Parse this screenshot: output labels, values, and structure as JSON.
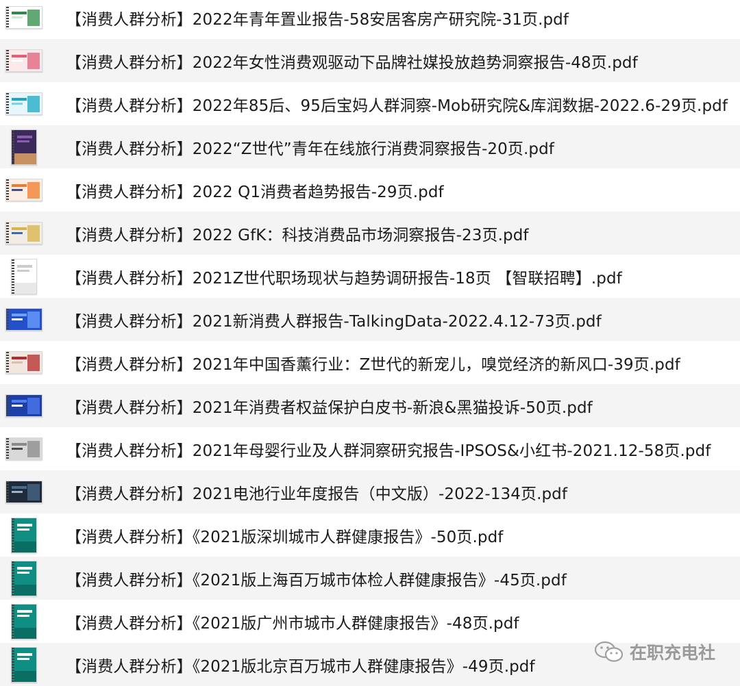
{
  "files": [
    {
      "name": "【消费人群分析】2022年青年置业报告-58安居客房产研究院-31页.pdf",
      "thumb": {
        "shape": "land",
        "bg": "#ffffff",
        "accent": "#2e8b47",
        "accent2": "#cfe9d6"
      }
    },
    {
      "name": "【消费人群分析】2022年女性消费观驱动下品牌社媒投放趋势洞察报告-48页.pdf",
      "thumb": {
        "shape": "land",
        "bg": "#fbe9ec",
        "accent": "#e0607a",
        "accent2": "#ffffff"
      }
    },
    {
      "name": "【消费人群分析】2022年85后、95后宝妈人群洞察-Mob研究院&库润数据-2022.6-29页.pdf",
      "thumb": {
        "shape": "land",
        "bg": "#e6f6fa",
        "accent": "#1aa7c4",
        "accent2": "#7ad3e3"
      }
    },
    {
      "name": "【消费人群分析】2022“Z世代”青年在线旅行消费洞察报告-20页.pdf",
      "thumb": {
        "shape": "port",
        "bg": "#3b2a5a",
        "accent": "#8a5db0",
        "accent2": "#c79060"
      }
    },
    {
      "name": "【消费人群分析】2022 Q1消费者趋势报告-29页.pdf",
      "thumb": {
        "shape": "land",
        "bg": "#fdeee3",
        "accent": "#f07a2a",
        "accent2": "#4a4a8a"
      }
    },
    {
      "name": "【消费人群分析】2022 GfK：科技消费品市场洞察报告-23页.pdf",
      "thumb": {
        "shape": "land",
        "bg": "#f1ede4",
        "accent": "#d8b24a",
        "accent2": "#3d67b0"
      }
    },
    {
      "name": "【消费人群分析】2021Z世代职场现状与趋势调研报告-18页 【智联招聘】.pdf",
      "thumb": {
        "shape": "port",
        "bg": "#ffffff",
        "accent": "#cccccc",
        "accent2": "#e8e8e8"
      }
    },
    {
      "name": "【消费人群分析】2021新消费人群报告-TalkingData-2022.4.12-73页.pdf",
      "thumb": {
        "shape": "land",
        "bg": "#2350c8",
        "accent": "#6fa0ff",
        "accent2": "#ffffff"
      }
    },
    {
      "name": "【消费人群分析】2021年中国香薰行业：Z世代的新宠儿，嗅觉经济的新风口-39页.pdf",
      "thumb": {
        "shape": "land",
        "bg": "#f3e6df",
        "accent": "#b32a2a",
        "accent2": "#d7bfb2"
      }
    },
    {
      "name": "【消费人群分析】2021年消费者权益保护白皮书-新浪&黑猫投诉-50页.pdf",
      "thumb": {
        "shape": "land",
        "bg": "#1d3fa8",
        "accent": "#4f7cf0",
        "accent2": "#ffffff"
      }
    },
    {
      "name": "【消费人群分析】2021年母婴行业及人群洞察研究报告-IPSOS&小红书-2021.12-58页.pdf",
      "thumb": {
        "shape": "land",
        "bg": "#d9d9d9",
        "accent": "#8a8a8a",
        "accent2": "#4a4a4a"
      }
    },
    {
      "name": "【消费人群分析】2021电池行业年度报告（中文版）-2022-134页.pdf",
      "thumb": {
        "shape": "land",
        "bg": "#1f2a3a",
        "accent": "#4a6a8a",
        "accent2": "#9fb3c8"
      }
    },
    {
      "name": "【消费人群分析】《2021版深圳城市人群健康报告》-50页.pdf",
      "thumb": {
        "shape": "port",
        "bg": "#0f8f83",
        "accent": "#ffffff",
        "accent2": "#0b6e65"
      }
    },
    {
      "name": "【消费人群分析】《2021版上海百万城市体检人群健康报告》-45页.pdf",
      "thumb": {
        "shape": "port",
        "bg": "#0f8f83",
        "accent": "#ffffff",
        "accent2": "#0b6e65"
      }
    },
    {
      "name": "【消费人群分析】《2021版广州市城市人群健康报告》-48页.pdf",
      "thumb": {
        "shape": "port",
        "bg": "#0f8f83",
        "accent": "#ffffff",
        "accent2": "#0b6e65"
      }
    },
    {
      "name": "【消费人群分析】《2021版北京百万城市人群健康报告》-49页.pdf",
      "thumb": {
        "shape": "port",
        "bg": "#0f8f83",
        "accent": "#ffffff",
        "accent2": "#0b6e65"
      }
    }
  ],
  "watermark": {
    "text": "在职充电社",
    "icon": "wechat-icon"
  }
}
